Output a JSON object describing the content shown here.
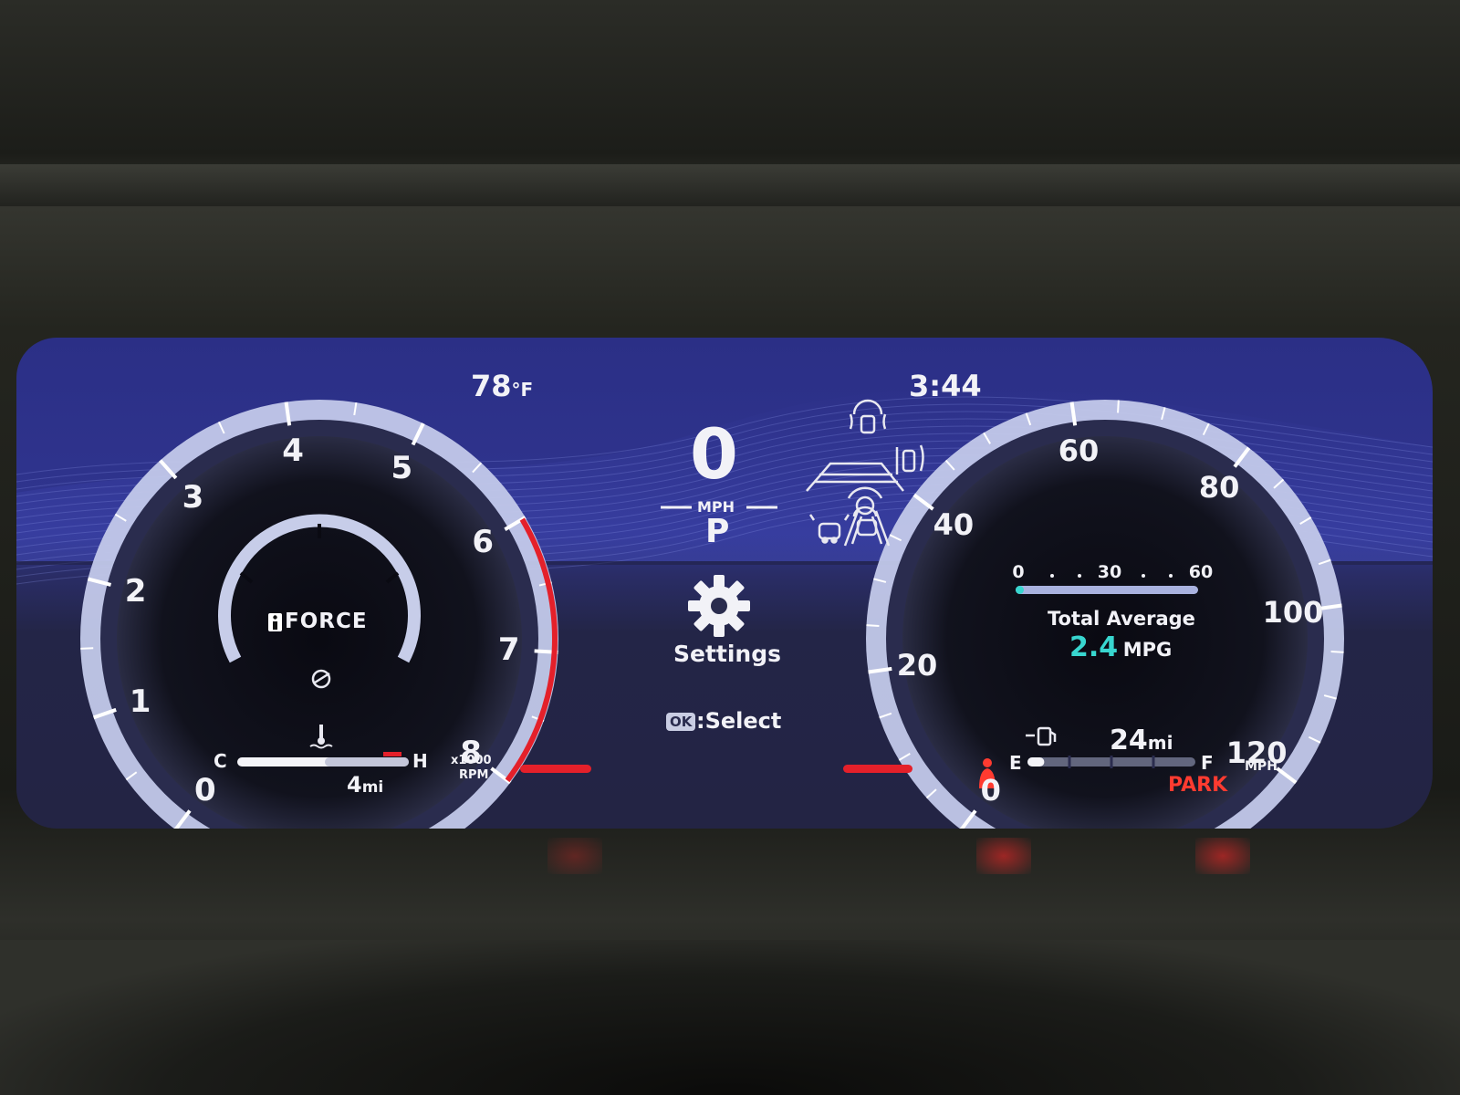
{
  "colors": {
    "screen_blue": "#2f3590",
    "gauge_ring": "#a9b2df",
    "redline": "#e4202a",
    "mpg_accent": "#38d6cf",
    "park_red": "#ff3b30",
    "text_white": "#f2f2f7"
  },
  "header": {
    "outside_temp": "78",
    "temp_unit": "°F",
    "clock": "3:44"
  },
  "tachometer": {
    "ticks": [
      "0",
      "1",
      "2",
      "3",
      "4",
      "5",
      "6",
      "7",
      "8"
    ],
    "unit_multiplier": "x1000",
    "unit": "RPM",
    "brand_logo_text": "FORCE",
    "redline_from": 6
  },
  "temperature_gauge": {
    "cold_label": "C",
    "hot_label": "H",
    "icon": "coolant-temp-icon",
    "trip_distance_value": "4",
    "trip_distance_unit": "mi"
  },
  "center": {
    "speed_value": "0",
    "speed_unit": "MPH",
    "gear": "P",
    "menu_icon": "gear-icon",
    "menu_label": "Settings",
    "ok_key": "OK",
    "ok_action": ":Select",
    "indicators": [
      "driver-assist-icon",
      "parking-sensor-icon",
      "lane-keeping-icon",
      "driver-monitor-icon",
      "pre-collision-icon",
      "lane-trace-icon"
    ]
  },
  "speedometer": {
    "ticks": [
      "0",
      "20",
      "40",
      "60",
      "80",
      "100",
      "120"
    ],
    "unit": "MPH",
    "mpg_scale": [
      "0",
      "30",
      "60"
    ],
    "mpg_label": "Total Average",
    "mpg_value": "2.4",
    "mpg_unit": "MPG",
    "mpg_fraction": 0.02
  },
  "fuel_gauge": {
    "empty_label": "E",
    "full_label": "F",
    "icon": "fuel-pump-icon",
    "range_value": "24",
    "range_unit": "mi",
    "fuel_fraction": 0.1
  },
  "warnings": {
    "seatbelt_icon": "seatbelt-warning-icon",
    "park_label": "PARK"
  }
}
